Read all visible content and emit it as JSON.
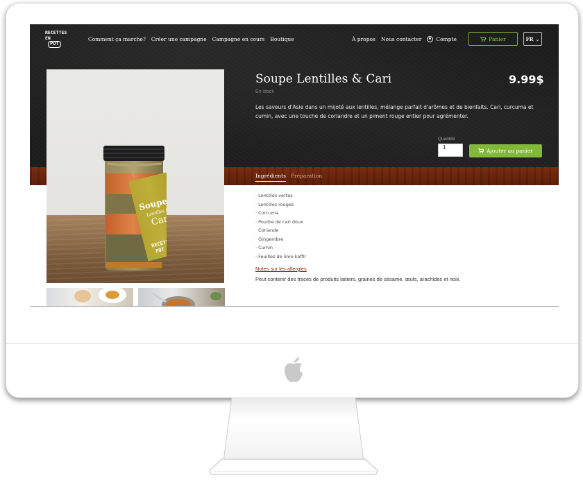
{
  "nav": {
    "logo_line1": "RECETTES",
    "logo_line2": "EN",
    "logo_line3": "POT",
    "items_left": [
      "Comment ça marche?",
      "Créer une campagne",
      "Campagne en cours",
      "Boutique"
    ],
    "items_right": [
      "À propos",
      "Nous contacter"
    ],
    "account_label": "Compte",
    "cart_label": "Panier",
    "language": "FR"
  },
  "product": {
    "title": "Soupe Lentilles & Cari",
    "price": "9.99$",
    "stock_status": "En stock",
    "description": "Les saveurs d'Asie dans un mijoté aux lentilles, mélange parfait d'arômes et de bienfaits. Cari, curcuma et cumin, avec une touche de coriandre et un piment rouge entier pour agrémenter.",
    "quantity_label": "Quantité",
    "quantity_value": "1",
    "add_to_cart_label": "Ajouter au panier",
    "jar_label_line1": "Soupe",
    "jar_label_line2": "Lentilles &",
    "jar_label_line3": "Cari",
    "jar_brand_line1": "RECETTES",
    "jar_brand_line2": "POT"
  },
  "tabs": [
    {
      "label": "Ingrédients",
      "active": true
    },
    {
      "label": "Préparation",
      "active": false
    }
  ],
  "ingredients": [
    "· Lentilles vertes",
    "· Lentilles rouges",
    "· Curcuma",
    "· Poudre de cari doux",
    "· Coriande",
    "· Gingembre",
    "· Cumin",
    "· Feuilles de lime kaffir"
  ],
  "allergy": {
    "title": "Notes sur les allergies",
    "text": "Peut contenir des traces de produits laitiers, graines de sésame, œufs, arachides et noix."
  },
  "colors": {
    "accent_green": "#82b93b",
    "wood_brown": "#6b260e",
    "hero_dark": "#1c1c1c"
  }
}
